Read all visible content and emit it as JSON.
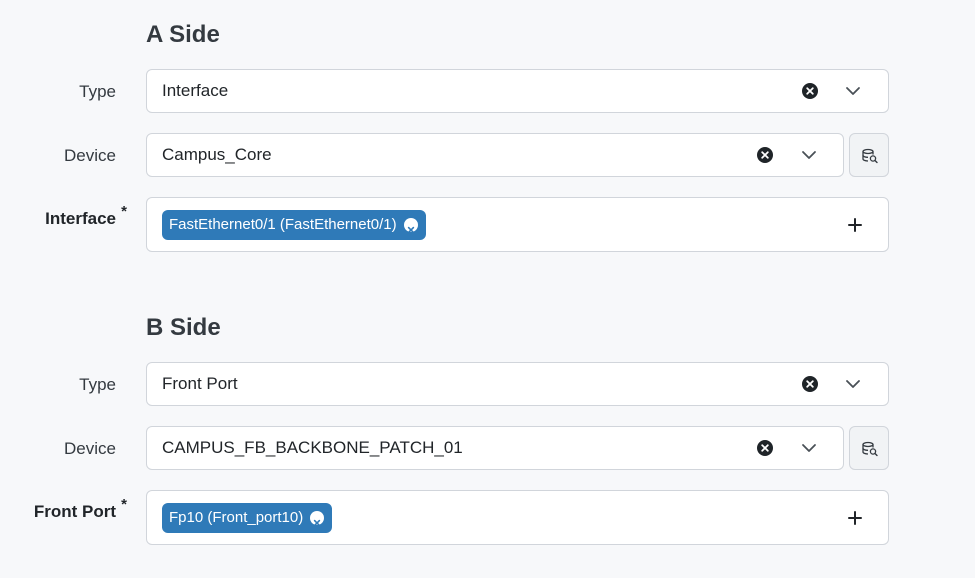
{
  "a_side": {
    "title": "A Side",
    "type": {
      "label": "Type",
      "value": "Interface"
    },
    "device": {
      "label": "Device",
      "value": "Campus_Core"
    },
    "termination": {
      "label": "Interface",
      "required_marker": "*",
      "tag": "FastEthernet0/1 (FastEthernet0/1)"
    }
  },
  "b_side": {
    "title": "B Side",
    "type": {
      "label": "Type",
      "value": "Front Port"
    },
    "device": {
      "label": "Device",
      "value": "CAMPUS_FB_BACKBONE_PATCH_01"
    },
    "termination": {
      "label": "Front Port",
      "required_marker": "*",
      "tag": "Fp10 (Front_port10)"
    }
  },
  "icons": {
    "clear": "clear-circle-icon",
    "chevron": "chevron-down-icon",
    "add": "plus-icon",
    "selector": "database-search-icon",
    "tag_remove": "tag-remove-icon"
  },
  "colors": {
    "tag_background": "#2f7ab8",
    "page_background": "#f7f8fa",
    "field_border": "#d1d5db"
  }
}
